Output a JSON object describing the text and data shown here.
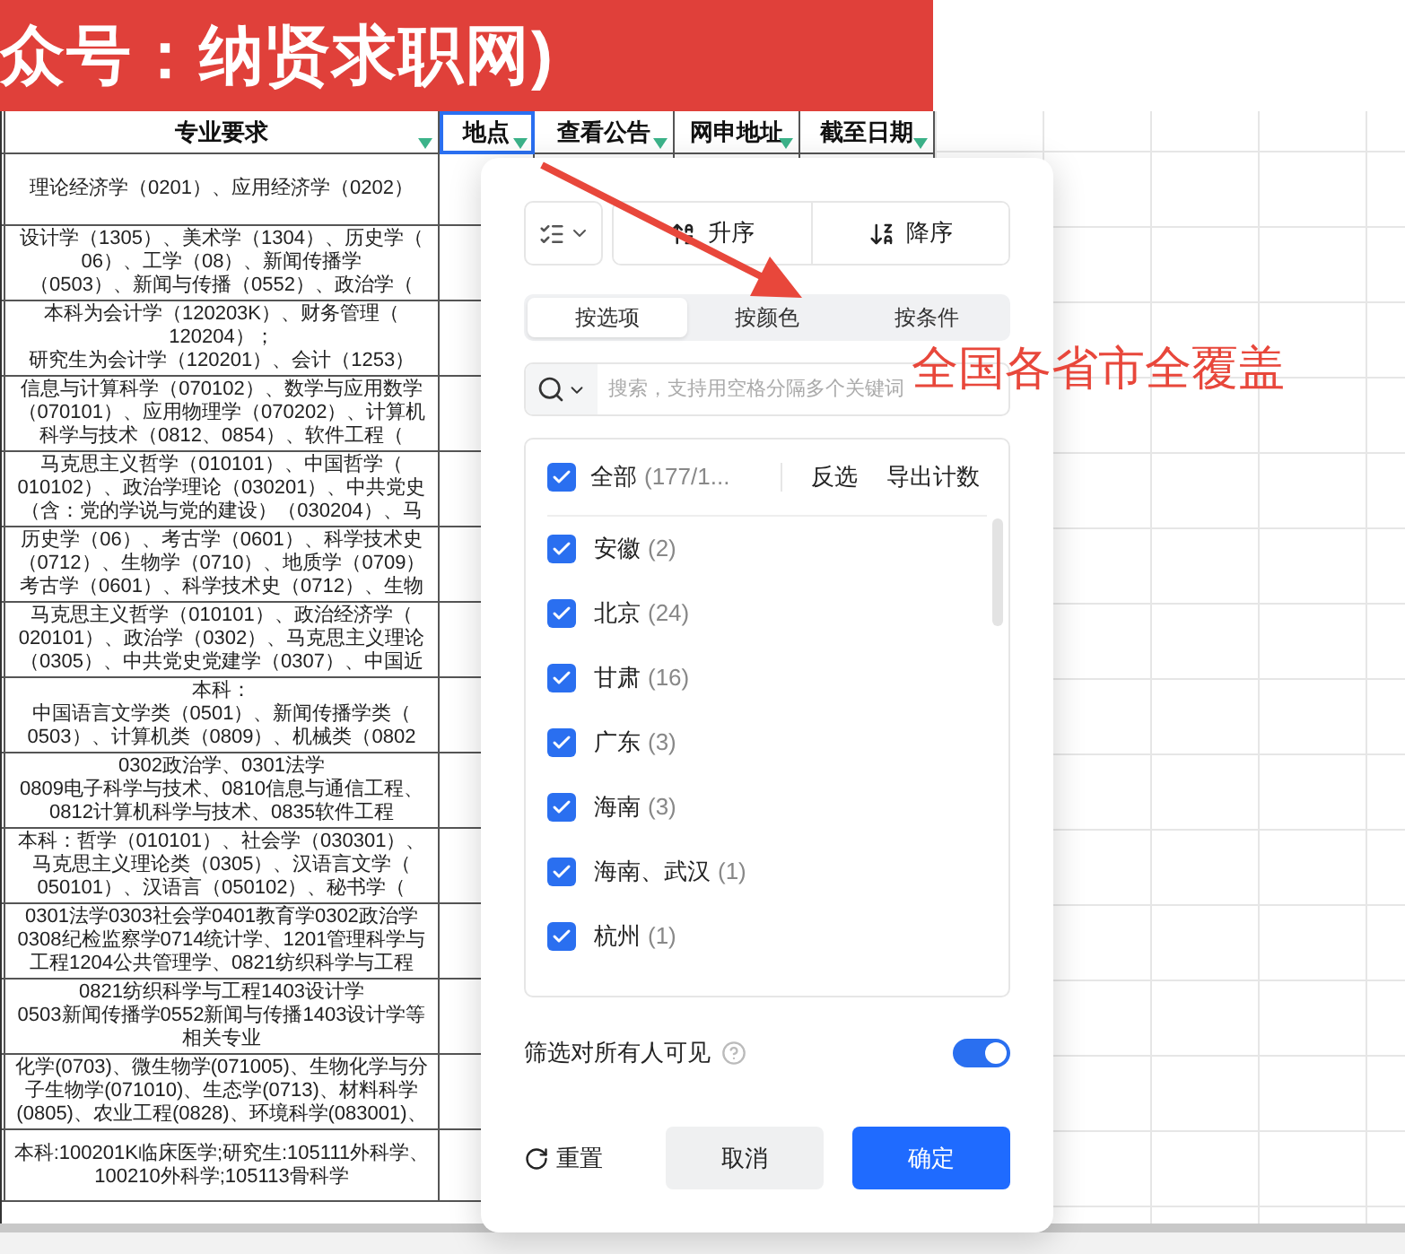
{
  "banner": {
    "title": "众号：纳贤求职网)"
  },
  "sheet": {
    "columns": [
      {
        "label": "专业要求",
        "selected": false
      },
      {
        "label": "地点",
        "selected": true
      },
      {
        "label": "查看公告",
        "selected": false
      },
      {
        "label": "网申地址",
        "selected": false
      },
      {
        "label": "截至日期",
        "selected": false
      }
    ],
    "rows": [
      {
        "major": [
          "理论经济学（0201）、应用经济学（0202）"
        ]
      },
      {
        "major": [
          "设计学（1305）、美术学（1304）、历史学（",
          "06）、工学（08）、新闻传播学",
          "（0503）、新闻与传播（0552）、政治学（"
        ]
      },
      {
        "major": [
          "本科为会计学（120203K）、财务管理（",
          "120204）；",
          "研究生为会计学（120201）、会计（1253）"
        ]
      },
      {
        "major": [
          "信息与计算科学（070102）、数学与应用数学",
          "（070101）、应用物理学（070202）、计算机",
          "科学与技术（0812、0854）、软件工程（"
        ]
      },
      {
        "major": [
          "马克思主义哲学（010101）、中国哲学（",
          "010102）、政治学理论（030201）、中共党史",
          "（含：党的学说与党的建设）（030204）、马"
        ]
      },
      {
        "major": [
          "历史学（06）、考古学（0601）、科学技术史",
          "（0712）、生物学（0710）、地质学（0709）",
          "考古学（0601）、科学技术史（0712）、生物"
        ]
      },
      {
        "major": [
          "马克思主义哲学（010101）、政治经济学（",
          "020101）、政治学（0302）、马克思主义理论",
          "（0305）、中共党史党建学（0307）、中国近"
        ]
      },
      {
        "major": [
          "本科：",
          "中国语言文学类（0501）、新闻传播学类（",
          "0503）、计算机类（0809）、机械类（0802"
        ]
      },
      {
        "major": [
          "0302政治学、0301法学",
          "0809电子科学与技术、0810信息与通信工程、",
          "0812计算机科学与技术、0835软件工程"
        ]
      },
      {
        "major": [
          "本科：哲学（010101）、社会学（030301）、",
          "马克思主义理论类（0305）、汉语言文学（",
          "050101）、汉语言（050102）、秘书学（"
        ]
      },
      {
        "major": [
          "0301法学0303社会学0401教育学0302政治学",
          "0308纪检监察学0714统计学、1201管理科学与",
          "工程1204公共管理学、0821纺织科学与工程"
        ]
      },
      {
        "major": [
          "0821纺织科学与工程1403设计学",
          "0503新闻传播学0552新闻与传播1403设计学等",
          "相关专业"
        ]
      },
      {
        "major": [
          "化学(0703)、微生物学(071005)、生物化学与分",
          "子生物学(071010)、生态学(0713)、材料科学",
          "(0805)、农业工程(0828)、环境科学(083001)、"
        ]
      },
      {
        "major": [
          "本科:100201K临床医学;研究生:105111外科学、",
          "100210外科学;105113骨科学"
        ]
      }
    ]
  },
  "annotation": {
    "text": "全国各省市全覆盖"
  },
  "filter_popup": {
    "sort_buttons": [
      {
        "label": "升序",
        "kind": "asc"
      },
      {
        "label": "降序",
        "kind": "desc"
      }
    ],
    "tabs": [
      {
        "label": "按选项",
        "selected": true
      },
      {
        "label": "按颜色",
        "selected": false
      },
      {
        "label": "按条件",
        "selected": false
      }
    ],
    "search": {
      "placeholder": "搜索，支持用空格分隔多个关键词"
    },
    "select_all": {
      "label": "全部",
      "count": "(177/1...",
      "checked": true
    },
    "list_actions": [
      "反选",
      "导出计数"
    ],
    "options": [
      {
        "label": "安徽",
        "count": "(2)",
        "checked": true
      },
      {
        "label": "北京",
        "count": "(24)",
        "checked": true
      },
      {
        "label": "甘肃",
        "count": "(16)",
        "checked": true
      },
      {
        "label": "广东",
        "count": "(3)",
        "checked": true
      },
      {
        "label": "海南",
        "count": "(3)",
        "checked": true
      },
      {
        "label": "海南、武汉",
        "count": "(1)",
        "checked": true
      },
      {
        "label": "杭州",
        "count": "(1)",
        "checked": true
      }
    ],
    "visibility": {
      "label": "筛选对所有人可见",
      "on": true
    },
    "reset": "重置",
    "buttons": [
      {
        "label": "取消",
        "kind": "secondary"
      },
      {
        "label": "确定",
        "kind": "primary"
      }
    ]
  }
}
